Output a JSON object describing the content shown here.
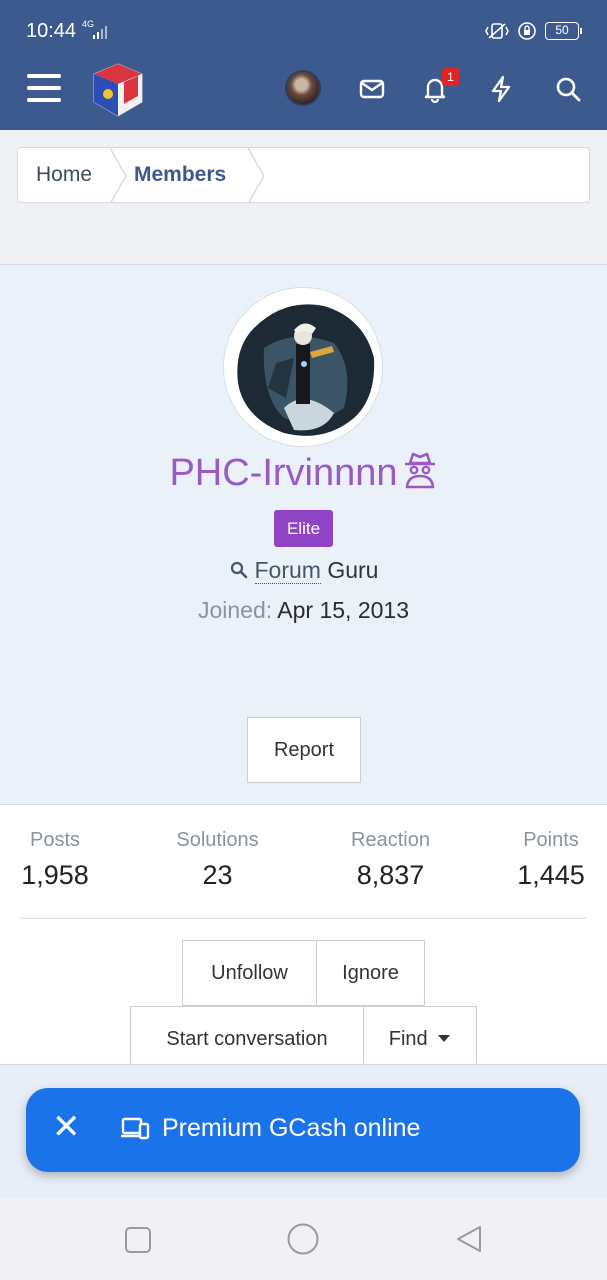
{
  "status_bar": {
    "time": "10:44",
    "network": "4G",
    "battery": "50"
  },
  "header": {
    "notification_count": "1"
  },
  "breadcrumb": {
    "items": [
      "Home",
      "Members"
    ]
  },
  "profile": {
    "username": "PHC-Irvinnnn",
    "banner": "Elite",
    "title_link": "Forum",
    "title_rest": " Guru",
    "joined_label": "Joined:",
    "joined_value": "Apr 15, 2013",
    "report_label": "Report",
    "username_color": "#9b59c6",
    "banner_color": "#8e44c4"
  },
  "stats": [
    {
      "label": "Posts",
      "value": "1,958"
    },
    {
      "label": "Solutions",
      "value": "23"
    },
    {
      "label": "Reaction",
      "value": "8,837"
    },
    {
      "label": "Points",
      "value": "1,445"
    }
  ],
  "actions": {
    "unfollow": "Unfollow",
    "ignore": "Ignore",
    "start_conversation": "Start conversation",
    "find": "Find"
  },
  "ad": {
    "text": "Premium GCash online",
    "color": "#1a73e8"
  },
  "theme": {
    "header_color": "#3c5a8d",
    "profile_bg": "#ebf1f9"
  }
}
